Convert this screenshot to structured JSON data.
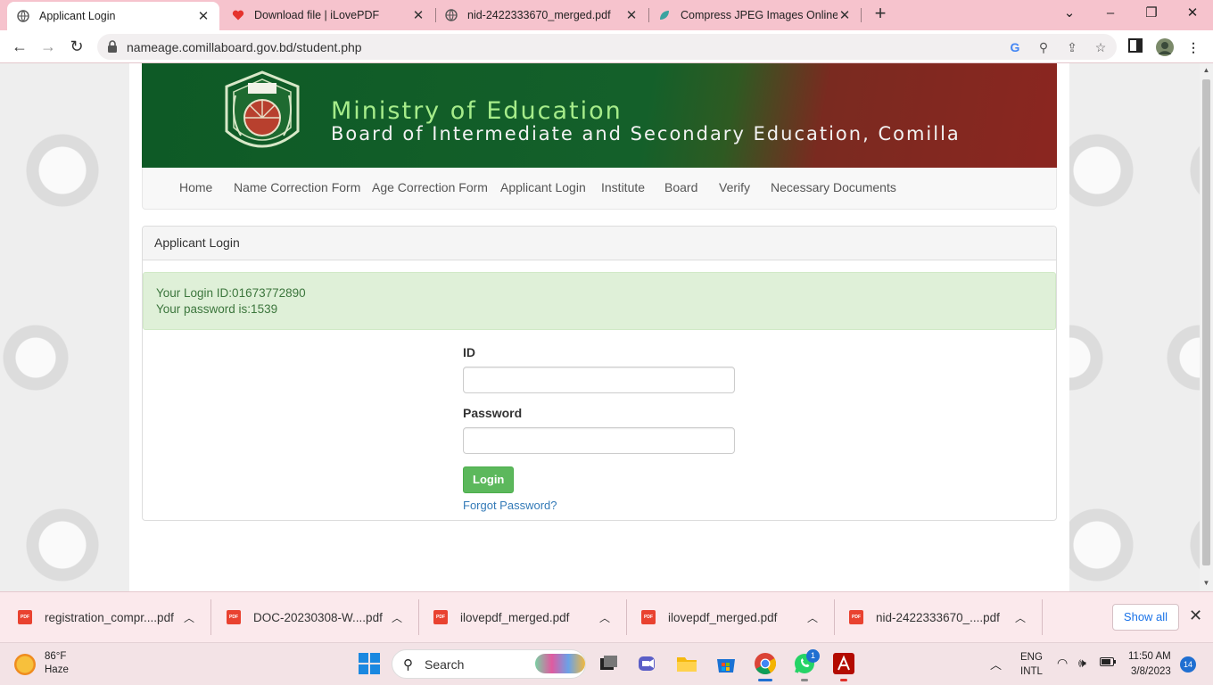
{
  "browser": {
    "tabs": [
      {
        "title": "Applicant Login",
        "active": true,
        "icon": "globe-icon"
      },
      {
        "title": "Download file | iLovePDF",
        "active": false,
        "icon": "heart-icon"
      },
      {
        "title": "nid-2422333670_merged.pdf",
        "active": false,
        "icon": "globe-icon"
      },
      {
        "title": "Compress JPEG Images Online",
        "active": false,
        "icon": "leaf-icon"
      }
    ],
    "url": "nameage.comillaboard.gov.bd/student.php"
  },
  "header": {
    "ministry": "Ministry of Education",
    "board": "Board of Intermediate and Secondary Education, Comilla"
  },
  "nav": {
    "items": [
      "Home",
      "Name Correction Form",
      "Age Correction Form",
      "Applicant Login",
      "Institute",
      "Board",
      "Verify",
      "Necessary Documents"
    ]
  },
  "panel": {
    "heading": "Applicant Login",
    "alert_line1": "Your Login ID:01673772890",
    "alert_line2": "Your password is:1539"
  },
  "form": {
    "id_label": "ID",
    "id_value": "",
    "password_label": "Password",
    "password_value": "",
    "login_label": "Login",
    "forgot_label": "Forgot Password?"
  },
  "downloads": {
    "files": [
      "registration_compr....pdf",
      "DOC-20230308-W....pdf",
      "ilovepdf_merged.pdf",
      "ilovepdf_merged.pdf",
      "nid-2422333670_....pdf"
    ],
    "show_all": "Show all"
  },
  "taskbar": {
    "weather_temp": "86°F",
    "weather_desc": "Haze",
    "search_label": "Search",
    "whatsapp_badge": "1",
    "lang_top": "ENG",
    "lang_bottom": "INTL",
    "time": "11:50 AM",
    "date": "3/8/2023",
    "notif_count": "14"
  },
  "colors": {
    "banner_green": "#0e5a26",
    "banner_red": "#8b2620",
    "alert_bg": "#dff0d8",
    "alert_text": "#3c763d",
    "login_button": "#5cb85c",
    "link": "#337ab7",
    "tabbar": "#f6c3cd"
  }
}
